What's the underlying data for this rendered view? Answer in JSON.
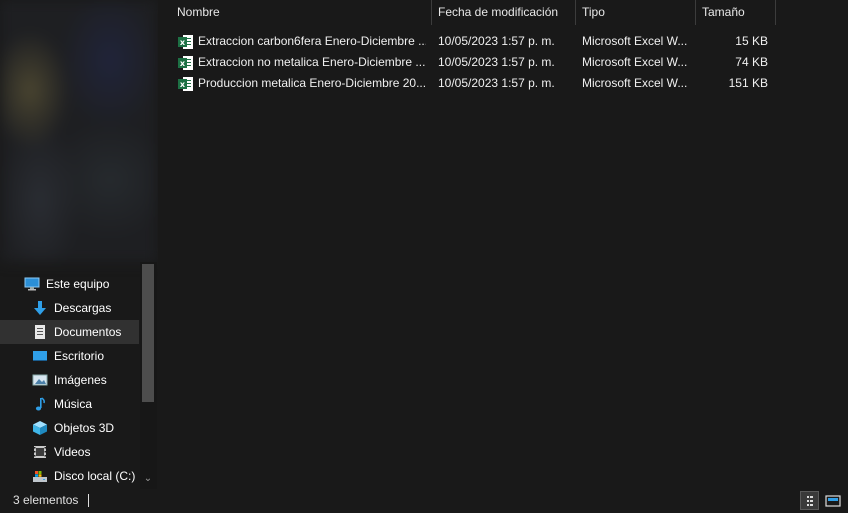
{
  "nav": {
    "items": [
      {
        "label": "Este equipo",
        "icon": "computer-icon",
        "selected": false
      },
      {
        "label": "Descargas",
        "icon": "download-arrow-icon",
        "selected": false
      },
      {
        "label": "Documentos",
        "icon": "document-icon",
        "selected": true
      },
      {
        "label": "Escritorio",
        "icon": "desktop-icon",
        "selected": false
      },
      {
        "label": "Imágenes",
        "icon": "pictures-icon",
        "selected": false
      },
      {
        "label": "Música",
        "icon": "music-note-icon",
        "selected": false
      },
      {
        "label": "Objetos 3D",
        "icon": "cube-3d-icon",
        "selected": false
      },
      {
        "label": "Videos",
        "icon": "video-film-icon",
        "selected": false
      },
      {
        "label": "Disco local (C:)",
        "icon": "local-disk-icon",
        "selected": false
      }
    ]
  },
  "columns": {
    "name": "Nombre",
    "modified": "Fecha de modificación",
    "type": "Tipo",
    "size": "Tamaño"
  },
  "files": [
    {
      "name": "Extraccion carbon6fera Enero-Diciembre ...",
      "modified": "10/05/2023 1:57 p. m.",
      "type": "Microsoft Excel W...",
      "size": "15 KB",
      "icon": "excel-file-icon"
    },
    {
      "name": "Extraccion no metalica Enero-Diciembre ...",
      "modified": "10/05/2023 1:57 p. m.",
      "type": "Microsoft Excel W...",
      "size": "74 KB",
      "icon": "excel-file-icon"
    },
    {
      "name": "Produccion metalica Enero-Diciembre 20...",
      "modified": "10/05/2023 1:57 p. m.",
      "type": "Microsoft Excel W...",
      "size": "151 KB",
      "icon": "excel-file-icon"
    }
  ],
  "status": {
    "count": "3 elementos"
  },
  "colors": {
    "background": "#191919",
    "selected": "#313131",
    "excel_green": "#1d7044",
    "accent_blue": "#2f9fe8"
  }
}
